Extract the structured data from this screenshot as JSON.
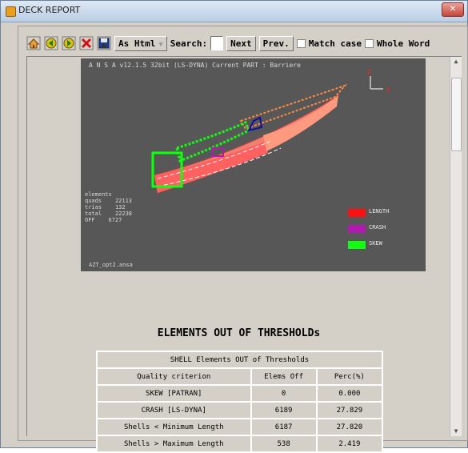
{
  "window": {
    "title": "DECK REPORT",
    "close_label": "✕"
  },
  "toolbar": {
    "icons": [
      "home-icon",
      "back-icon",
      "forward-icon",
      "close-icon",
      "save-icon"
    ],
    "format_select": "As Html",
    "search_label": "Search:",
    "search_value": "",
    "next_label": "Next",
    "prev_label": "Prev.",
    "match_case_label": "Match case",
    "whole_word_label": "Whole Word"
  },
  "viewport": {
    "header": "A N S A v12.1.5 32bit (LS-DYNA)   Current PART : Barriere",
    "stats": [
      {
        "label": "elements",
        "value": ""
      },
      {
        "label": "quads",
        "value": "22113"
      },
      {
        "label": "trias",
        "value": "132"
      },
      {
        "label": "total",
        "value": "22238"
      },
      {
        "label": "OFF",
        "value": "6727"
      }
    ],
    "file_name": "AZT_opt2.ansa",
    "axis_labels": {
      "z": "Z",
      "x": "X"
    },
    "legend": [
      {
        "label": "LENGTH",
        "color": "#ff1010"
      },
      {
        "label": "CRASH",
        "color": "#b01ab0"
      },
      {
        "label": "SKEW",
        "color": "#10ff10"
      }
    ]
  },
  "report": {
    "title": "ELEMENTS OUT OF THRESHOLDs",
    "table_caption": "SHELL Elements OUT of Thresholds",
    "columns": [
      "Quality criterion",
      "Elems Off",
      "Perc(%)"
    ],
    "rows": [
      [
        "SKEW [PATRAN]",
        "0",
        "0.000"
      ],
      [
        "CRASH [LS-DYNA]",
        "6189",
        "27.829"
      ],
      [
        "Shells < Minimum Length",
        "6187",
        "27.820"
      ],
      [
        "Shells > Maximum Length",
        "538",
        "2.419"
      ]
    ]
  }
}
